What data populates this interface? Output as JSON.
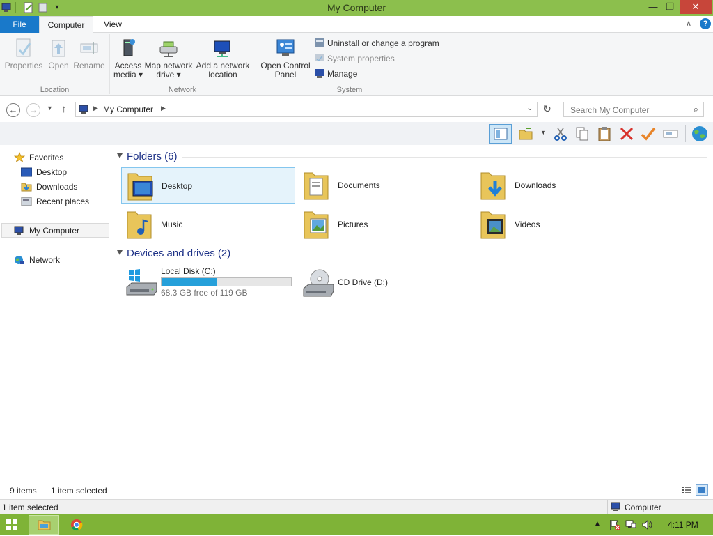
{
  "window": {
    "title": "My Computer"
  },
  "ribbon": {
    "tabs": [
      {
        "label": "File"
      },
      {
        "label": "Computer"
      },
      {
        "label": "View"
      }
    ],
    "location": {
      "group_label": "Location",
      "properties": "Properties",
      "open": "Open",
      "rename": "Rename"
    },
    "network": {
      "group_label": "Network",
      "access_media": [
        "Access",
        "media ▾"
      ],
      "map_network_drive": [
        "Map network",
        "drive ▾"
      ],
      "add_network_location": [
        "Add a network",
        "location"
      ]
    },
    "system": {
      "group_label": "System",
      "open_control_panel": [
        "Open Control",
        "Panel"
      ],
      "uninstall": "Uninstall or change a program",
      "system_properties": "System properties",
      "manage": "Manage"
    }
  },
  "address": {
    "path": "My Computer",
    "search_placeholder": "Search My Computer"
  },
  "nav_pane": {
    "favorites": "Favorites",
    "desktop": "Desktop",
    "downloads": "Downloads",
    "recent_places": "Recent places",
    "my_computer": "My Computer",
    "network": "Network"
  },
  "content": {
    "folders_header": "Folders (6)",
    "folders": [
      {
        "name": "Desktop"
      },
      {
        "name": "Documents"
      },
      {
        "name": "Downloads"
      },
      {
        "name": "Music"
      },
      {
        "name": "Pictures"
      },
      {
        "name": "Videos"
      }
    ],
    "drives_header": "Devices and drives (2)",
    "drives": [
      {
        "name": "Local Disk (C:)",
        "free_text": "68.3 GB free of 119 GB",
        "used_fraction": 0.426
      },
      {
        "name": "CD Drive (D:)"
      }
    ]
  },
  "status": {
    "item_count": "9 items",
    "selected": "1 item selected",
    "bottom_selected": "1 item selected",
    "bottom_location": "Computer"
  },
  "taskbar": {
    "clock": "4:11 PM"
  },
  "colors": {
    "titlebar": "#8cbf4d",
    "file_tab": "#1979ca",
    "taskbar": "#7fb337",
    "progress": "#26a0da",
    "close": "#c7463a"
  }
}
